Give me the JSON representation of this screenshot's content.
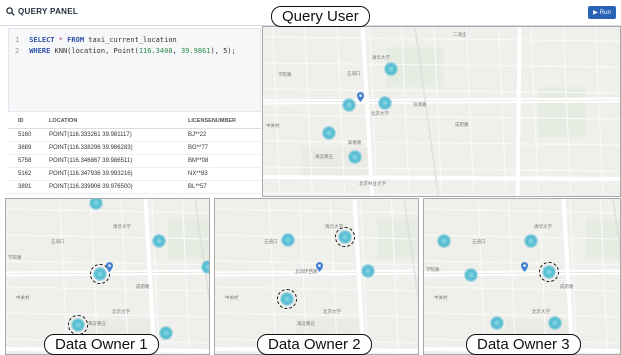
{
  "panel_title": "QUERY PANEL",
  "run_label": "Run",
  "labels": {
    "query_user": "Query User",
    "owner1": "Data Owner 1",
    "owner2": "Data Owner 2",
    "owner3": "Data Owner 3"
  },
  "editor": {
    "line_numbers": [
      "1",
      "2"
    ],
    "line1": {
      "kw1": "SELECT",
      "op": "*",
      "kw2": "FROM",
      "rest": "taxi_current_location"
    },
    "line2": {
      "kw1": "WHERE",
      "pre": "KNN(location, Point(",
      "n1": "116.3408",
      "sep": ", ",
      "n2": "39.9861",
      "post": "), 5);"
    }
  },
  "results": {
    "headers": [
      "ID",
      "LOCATION",
      "LICENSENUMBER"
    ],
    "rows": [
      [
        "5160",
        "POINT(116.333261 39.981117)",
        "BJ**22"
      ],
      [
        "3889",
        "POINT(116.338296 39.986283)",
        "BG**77"
      ],
      [
        "5758",
        "POINT(116.346867 39.986511)",
        "BM**08"
      ],
      [
        "5162",
        "POINT(116.347936 39.993216)",
        "NX**83"
      ],
      [
        "3891",
        "POINT(116.339906 39.976500)",
        "BL**57"
      ]
    ]
  },
  "map_labels": [
    "五道口",
    "学院路",
    "中关村",
    "北京大学",
    "清华大学",
    "双清路",
    "成府路",
    "北四环西路",
    "二道庄",
    "知春路",
    "海淀黄庄",
    "北京语言大学",
    "北京林业大学",
    "北京科技大学"
  ],
  "colors": {
    "accent": "#2a62b6",
    "marker": "#4fb9cf",
    "pin": "#3f7fd0"
  },
  "icons": [
    "search-icon",
    "play-icon",
    "location-pin-icon"
  ]
}
